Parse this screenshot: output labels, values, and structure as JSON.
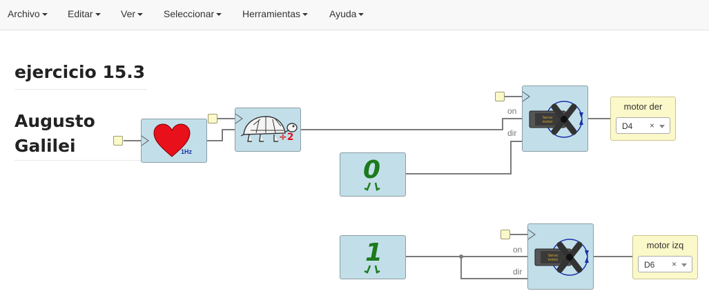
{
  "menu": {
    "items": [
      {
        "label": "Archivo"
      },
      {
        "label": "Editar"
      },
      {
        "label": "Ver"
      },
      {
        "label": "Seleccionar"
      },
      {
        "label": "Herramientas"
      },
      {
        "label": "Ayuda"
      }
    ]
  },
  "project": {
    "title": "ejercicio 15.3",
    "author_first": "Augusto",
    "author_last": "Galilei"
  },
  "blocks": {
    "heartbeat": {
      "freq_label": "1Hz",
      "icon": "heart-icon"
    },
    "divider": {
      "label": "÷2",
      "icon": "turtle-icon"
    },
    "const0": {
      "value": "0"
    },
    "const1": {
      "value": "1"
    },
    "motor_der": {
      "on_label": "on",
      "dir_label": "dir",
      "icon": "servo-icon"
    },
    "motor_izq": {
      "on_label": "on",
      "dir_label": "dir",
      "icon": "servo-icon"
    }
  },
  "outputs": {
    "motor_der": {
      "label": "motor der",
      "pin": "D4",
      "clear": "×"
    },
    "motor_izq": {
      "label": "motor izq",
      "pin": "D6",
      "clear": "×"
    }
  },
  "colors": {
    "block_bg": "#c2dfe9",
    "port_bg": "#fbf8c9",
    "heart": "#e8101a",
    "const_green": "#1c7a1c",
    "divider_red": "#e8101a"
  }
}
